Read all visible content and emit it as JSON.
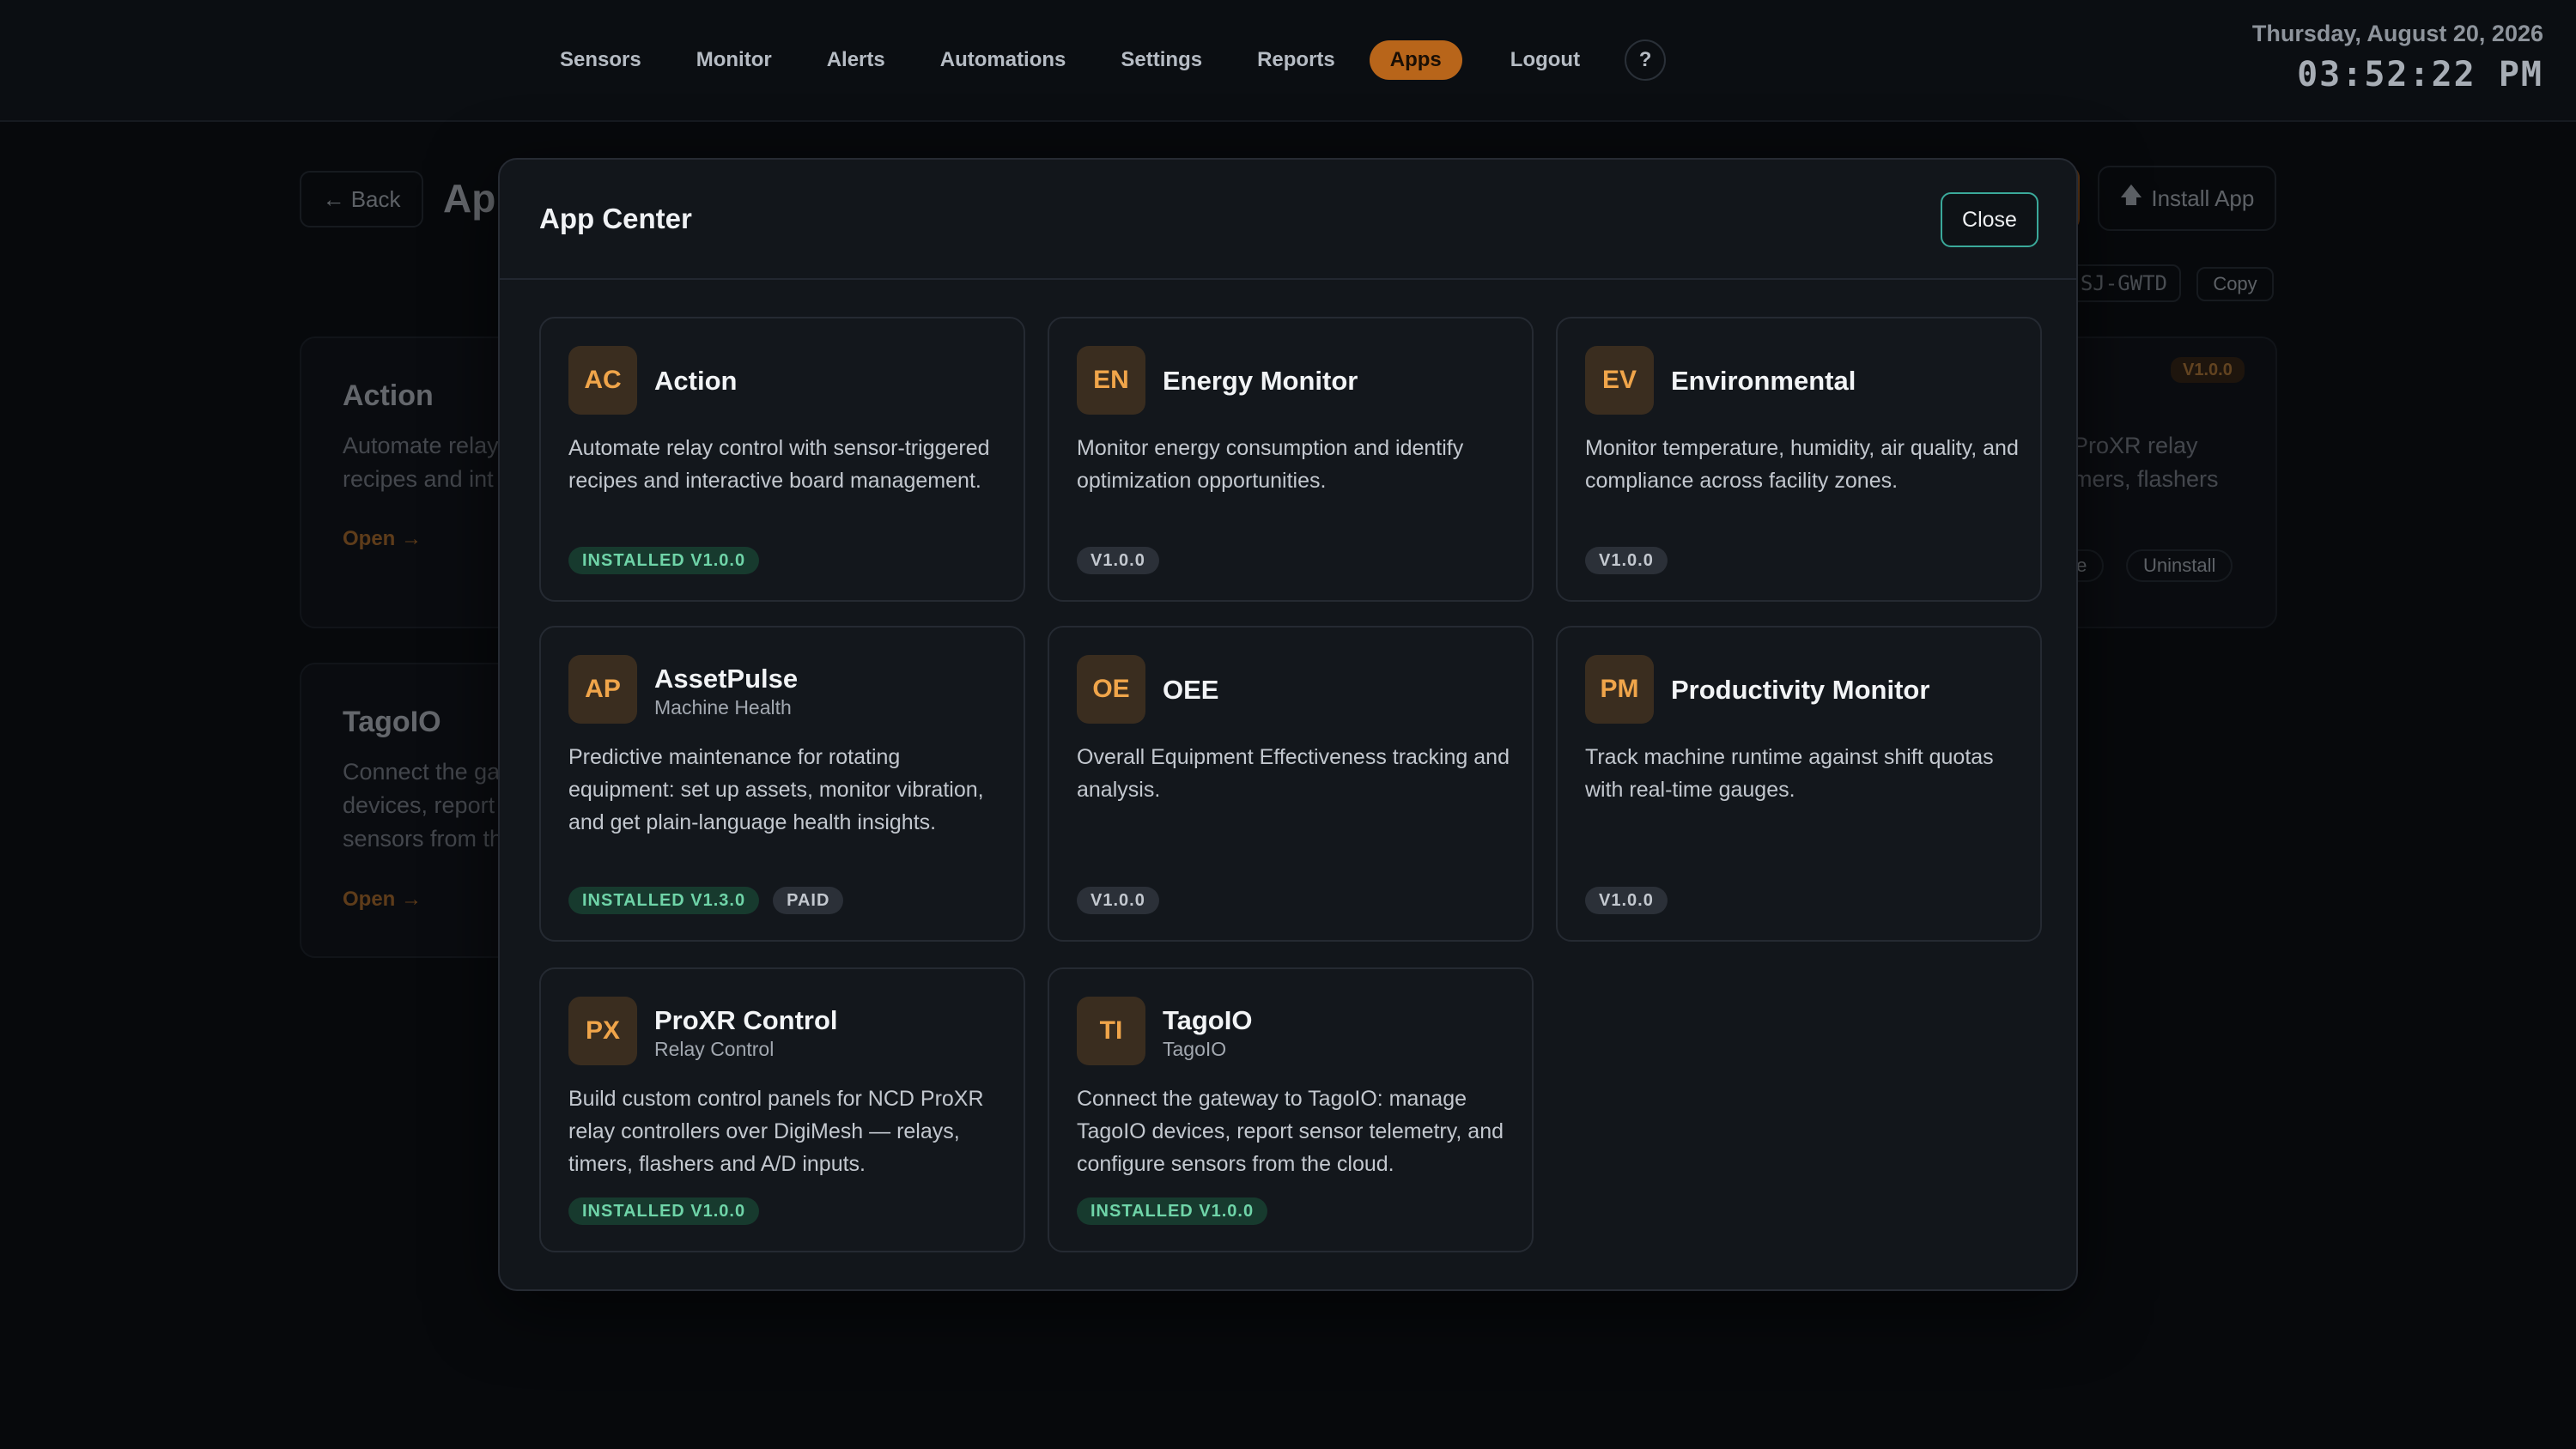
{
  "nav": {
    "items": [
      "Sensors",
      "Monitor",
      "Alerts",
      "Automations",
      "Settings",
      "Reports",
      "Apps",
      "Logout"
    ],
    "active": "Apps",
    "help_label": "?"
  },
  "clock": {
    "date": "Thursday, August 20, 2026",
    "time": "03:52:22 PM"
  },
  "background": {
    "back_label": "← Back",
    "title": "Ap",
    "install_label": "Install App",
    "install_icon": "upload-arrow-icon",
    "code": "SJ-GWTD",
    "copy_label": "Copy",
    "cards": [
      {
        "title": "Action",
        "desc_lines": [
          "Automate relay",
          "recipes and int"
        ],
        "open": "Open →"
      },
      {
        "title": "TagoIO",
        "desc_lines": [
          "Connect the ga",
          "devices, report",
          "sensors from th"
        ],
        "open": "Open →"
      }
    ],
    "right_card": {
      "version": "V1.0.0",
      "desc_lines": [
        "ProXR relay",
        "mers, flashers"
      ],
      "chip_partial": "te",
      "uninstall_label": "Uninstall"
    }
  },
  "modal": {
    "title": "App Center",
    "close_label": "Close",
    "apps": [
      {
        "initials": "AC",
        "name": "Action",
        "subtitle": "",
        "description": "Automate relay control with sensor-triggered recipes and interactive board management.",
        "badges": [
          {
            "text": "INSTALLED V1.0.0",
            "kind": "installed"
          }
        ]
      },
      {
        "initials": "EN",
        "name": "Energy Monitor",
        "subtitle": "",
        "description": "Monitor energy consumption and identify optimization opportunities.",
        "badges": [
          {
            "text": "V1.0.0",
            "kind": "ver"
          }
        ]
      },
      {
        "initials": "EV",
        "name": "Environmental",
        "subtitle": "",
        "description": "Monitor temperature, humidity, air quality, and compliance across facility zones.",
        "badges": [
          {
            "text": "V1.0.0",
            "kind": "ver"
          }
        ]
      },
      {
        "initials": "AP",
        "name": "AssetPulse",
        "subtitle": "Machine Health",
        "description": "Predictive maintenance for rotating equipment: set up assets, monitor vibration, and get plain-language health insights.",
        "badges": [
          {
            "text": "INSTALLED V1.3.0",
            "kind": "installed"
          },
          {
            "text": "PAID",
            "kind": "paid"
          }
        ]
      },
      {
        "initials": "OE",
        "name": "OEE",
        "subtitle": "",
        "description": "Overall Equipment Effectiveness tracking and analysis.",
        "badges": [
          {
            "text": "V1.0.0",
            "kind": "ver"
          }
        ]
      },
      {
        "initials": "PM",
        "name": "Productivity Monitor",
        "subtitle": "",
        "description": "Track machine runtime against shift quotas with real-time gauges.",
        "badges": [
          {
            "text": "V1.0.0",
            "kind": "ver"
          }
        ]
      },
      {
        "initials": "PX",
        "name": "ProXR Control",
        "subtitle": "Relay Control",
        "description": "Build custom control panels for NCD ProXR relay controllers over DigiMesh — relays, timers, flashers and A/D inputs.",
        "badges": [
          {
            "text": "INSTALLED V1.0.0",
            "kind": "installed"
          }
        ]
      },
      {
        "initials": "TI",
        "name": "TagoIO",
        "subtitle": "TagoIO",
        "description": "Connect the gateway to TagoIO: manage TagoIO devices, report sensor telemetry, and configure sensors from the cloud.",
        "badges": [
          {
            "text": "INSTALLED V1.0.0",
            "kind": "installed"
          }
        ]
      }
    ]
  },
  "colors": {
    "accent": "#b8651a",
    "installed_badge": "#6fd4a8",
    "close_border": "#3aa99a",
    "icon_text": "#f0a54a"
  }
}
